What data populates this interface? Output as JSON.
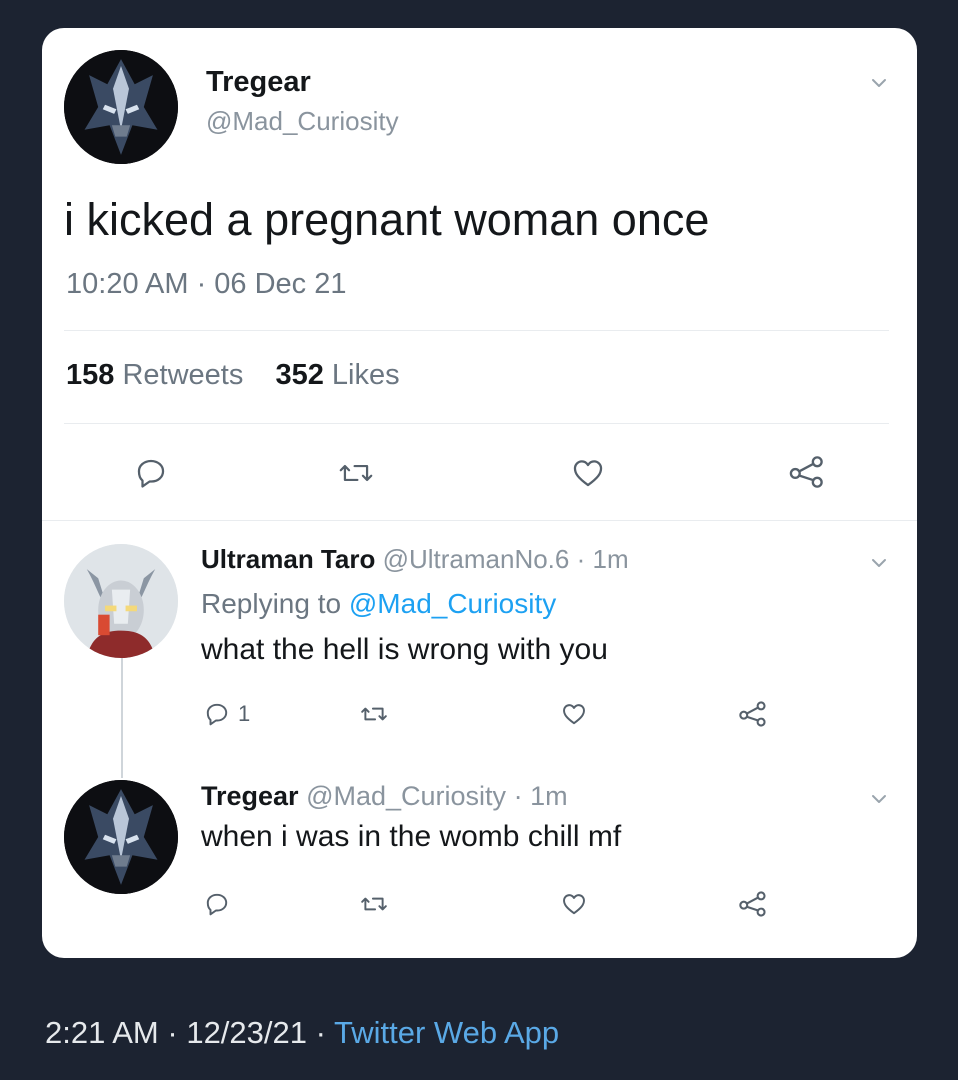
{
  "main_tweet": {
    "author_name": "Tregear",
    "author_handle": "@Mad_Curiosity",
    "text": "i kicked a pregnant woman once",
    "timestamp": "10:20 AM · 06 Dec 21",
    "retweets_count": "158",
    "retweets_label": "Retweets",
    "likes_count": "352",
    "likes_label": "Likes"
  },
  "replies": [
    {
      "author_name": "Ultraman Taro",
      "author_handle": "@UltramanNo.6",
      "separator": "·",
      "time": "1m",
      "replying_prefix": "Replying to",
      "replying_to": "@Mad_Curiosity",
      "text": "what the hell is wrong with you",
      "reply_count": "1"
    },
    {
      "author_name": "Tregear",
      "author_handle": "@Mad_Curiosity",
      "separator": "·",
      "time": "1m",
      "text": "when i was in the womb chill mf"
    }
  ],
  "footer": {
    "time": "2:21 AM",
    "date": "12/23/21",
    "separator": "·",
    "app": "Twitter Web App"
  },
  "icons": {
    "reply": "reply-icon",
    "retweet": "retweet-icon",
    "like": "heart-icon",
    "share": "share-icon",
    "more": "chevron-down-icon"
  },
  "colors": {
    "background": "#1c2331",
    "card": "#ffffff",
    "link": "#1da1f2",
    "footer_link": "#5aa9e6"
  }
}
